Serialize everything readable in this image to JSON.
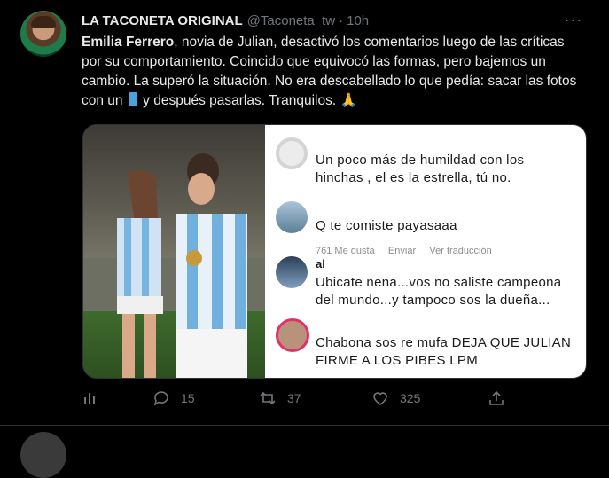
{
  "tweet": {
    "author_name": "LA TACONETA ORIGINAL",
    "handle": "@Taconeta_tw",
    "separator": "·",
    "time": "10h",
    "more": "···",
    "text_bold": "Emilia Ferrero",
    "text_1": ", novia de Julian, desactivó los comentarios luego de las críticas por su comportamiento. Coincido que equivocó las formas, pero bajemos un cambio. La superó la situación. No era descabellado lo que pedía: sacar las fotos con un",
    "text_2": " y después pasarlas. Tranquilos. ",
    "emoji_pray": "🙏"
  },
  "comments": [
    {
      "text": "Un poco más de humildad con los hinchas , el es la estrella, tú no.",
      "avatar_color": "#d8d8d8"
    },
    {
      "text": "Q te comiste payasaaa",
      "meta": "761 Me gusta     Enviar     Ver traducción",
      "avatar_color": "#7fa1b8"
    },
    {
      "user": "al",
      "text": "Ubicate nena...vos no saliste campeona del mundo...y tampoco sos la dueña...",
      "avatar_color": "#5d7fa3"
    },
    {
      "text": "Chabona sos re mufa DEJA QUE JULIAN FIRME A LOS PIBES LPM",
      "avatar_color": "#b8927a"
    }
  ],
  "actions": {
    "replies": "15",
    "retweets": "37",
    "likes": "325"
  },
  "colors": {
    "background": "#000000",
    "text": "#e7e9ea",
    "muted": "#71767b",
    "divider": "#2f3336"
  }
}
